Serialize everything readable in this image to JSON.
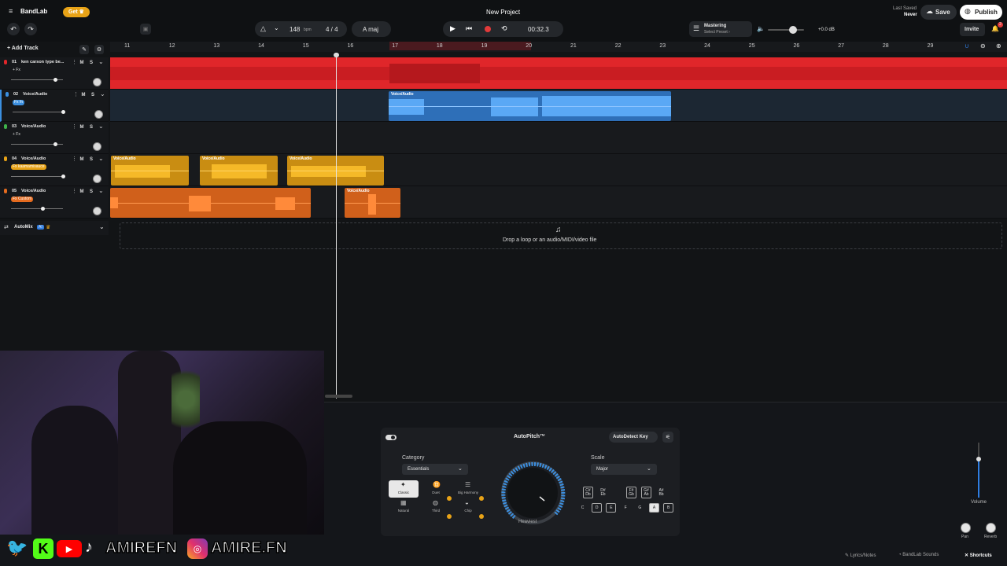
{
  "header": {
    "logo": "BandLab",
    "get_label": "Get",
    "project_title": "New Project",
    "last_saved_label": "Last Saved",
    "last_saved_value": "Never",
    "save_label": "Save",
    "publish_label": "Publish"
  },
  "toolbar": {
    "bpm": "148",
    "bpm_unit": "bpm",
    "time_sig": "4 / 4",
    "key": "A maj",
    "time": "00:32.3",
    "mastering_title": "Mastering",
    "mastering_sub": "Select Preset ›",
    "master_db": "+0.0 dB",
    "invite_label": "Invite",
    "notif_count": "2",
    "add_track_label": "Add Track"
  },
  "ruler": {
    "bars": [
      "11",
      "12",
      "13",
      "14",
      "15",
      "16",
      "17",
      "18",
      "19",
      "20",
      "21",
      "22",
      "23",
      "24",
      "25",
      "26",
      "27",
      "28",
      "29"
    ]
  },
  "tracks": [
    {
      "num": "01",
      "name": "ken carson type be...",
      "fx": "+ Fx",
      "color": "#e0262a",
      "vol": 0.85
    },
    {
      "num": "02",
      "name": "Voice/Audio",
      "fx": "Fx fn",
      "color": "#3b8fe0",
      "vol": 0.97
    },
    {
      "num": "03",
      "name": "Voice/Audio",
      "fx": "+ Fx",
      "color": "#3fb24a",
      "vol": 0.85
    },
    {
      "num": "04",
      "name": "Voice/Audio",
      "fx": "Fx kaamamisauce",
      "color": "#e8a317",
      "vol": 1.0
    },
    {
      "num": "05",
      "name": "Voice/Audio",
      "fx": "Fx Custom",
      "color": "#e56b1f",
      "vol": 0.6
    }
  ],
  "track_controls": {
    "mute": "M",
    "solo": "S"
  },
  "clips": {
    "voice_label": "Voice/Audio"
  },
  "automix": {
    "label": "AutoMix",
    "badge": "AI"
  },
  "drop_zone": {
    "text": "Drop a loop or an audio/MIDI/video file"
  },
  "autopitch": {
    "title": "AutoPitch™",
    "autodetect_label": "AutoDetect Key",
    "category_label": "Category",
    "category_value": "Essentials",
    "scale_label": "Scale",
    "scale_value": "Major",
    "knob_label": "Heaviest",
    "effects": [
      "Classic",
      "Duet",
      "Big Harmony",
      "Natural",
      "Third",
      "Chip"
    ],
    "sharp_keys": [
      [
        "C#",
        "Db"
      ],
      [
        "D#",
        "Eb"
      ],
      [
        "F#",
        "Gb"
      ],
      [
        "G#",
        "Ab"
      ],
      [
        "A#",
        "Bb"
      ]
    ],
    "keys": [
      "C",
      "D",
      "E",
      "F",
      "G",
      "A",
      "B"
    ]
  },
  "right_panel": {
    "volume_label": "Volume",
    "pan_label": "Pan",
    "reverb_label": "Reverb",
    "volume_level": 0.72
  },
  "footer": {
    "lyrics_label": "Lyrics/Notes",
    "sounds_label": "BandLab Sounds",
    "shortcuts_label": "Shortcuts"
  },
  "overlay": {
    "handle1": "AMIREFN",
    "handle2": "AMIRE.FN"
  },
  "colors": {
    "red": "#e0262a",
    "blue": "#3b8fe0",
    "gold": "#e8a317",
    "orange": "#e56b1f",
    "accent": "#2f7de1"
  }
}
